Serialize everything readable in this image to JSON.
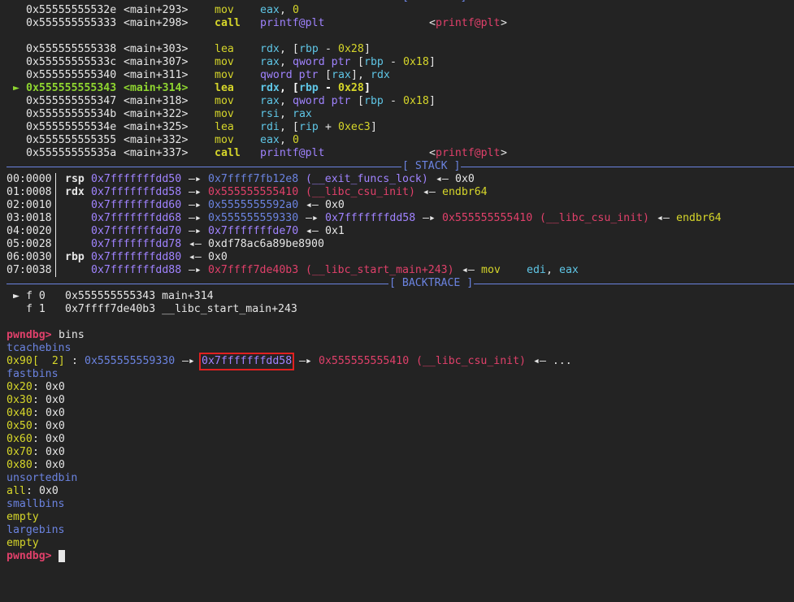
{
  "disasm": [
    {
      "addr": "0x55555555532e",
      "off": "<main+293>",
      "mn": "mov",
      "ops": [
        [
          "eax",
          "cy"
        ],
        [
          ", ",
          "w"
        ],
        [
          "0",
          "y"
        ]
      ]
    },
    {
      "addr": "0x555555555333",
      "off": "<main+298>",
      "mn": "call",
      "ops": [
        [
          "printf@plt",
          "pu"
        ]
      ],
      "target": "printf@plt",
      "call": true
    },
    {
      "blank": true
    },
    {
      "addr": "0x555555555338",
      "off": "<main+303>",
      "mn": "lea",
      "ops": [
        [
          "rdx",
          "cy"
        ],
        [
          ", [",
          "w"
        ],
        [
          "rbp",
          "cy"
        ],
        [
          " - ",
          "w"
        ],
        [
          "0x28",
          "y"
        ],
        [
          "]",
          "w"
        ]
      ]
    },
    {
      "addr": "0x55555555533c",
      "off": "<main+307>",
      "mn": "mov",
      "ops": [
        [
          "rax",
          "cy"
        ],
        [
          ", ",
          "w"
        ],
        [
          "qword ptr",
          "pu"
        ],
        [
          " [",
          "w"
        ],
        [
          "rbp",
          "cy"
        ],
        [
          " - ",
          "w"
        ],
        [
          "0x18",
          "y"
        ],
        [
          "]",
          "w"
        ]
      ]
    },
    {
      "addr": "0x555555555340",
      "off": "<main+311>",
      "mn": "mov",
      "ops": [
        [
          "qword ptr",
          "pu"
        ],
        [
          " [",
          "w"
        ],
        [
          "rax",
          "cy"
        ],
        [
          "], ",
          "w"
        ],
        [
          "rdx",
          "cy"
        ]
      ]
    },
    {
      "addr": "0x555555555343",
      "off": "<main+314>",
      "mn": "lea",
      "ops": [
        [
          "rdx",
          "cy"
        ],
        [
          ", [",
          "w"
        ],
        [
          "rbp",
          "cy"
        ],
        [
          " - ",
          "w"
        ],
        [
          "0x28",
          "y"
        ],
        [
          "]",
          "w"
        ]
      ],
      "current": true,
      "marker": "►"
    },
    {
      "addr": "0x555555555347",
      "off": "<main+318>",
      "mn": "mov",
      "ops": [
        [
          "rax",
          "cy"
        ],
        [
          ", ",
          "w"
        ],
        [
          "qword ptr",
          "pu"
        ],
        [
          " [",
          "w"
        ],
        [
          "rbp",
          "cy"
        ],
        [
          " - ",
          "w"
        ],
        [
          "0x18",
          "y"
        ],
        [
          "]",
          "w"
        ]
      ]
    },
    {
      "addr": "0x55555555534b",
      "off": "<main+322>",
      "mn": "mov",
      "ops": [
        [
          "rsi",
          "cy"
        ],
        [
          ", ",
          "w"
        ],
        [
          "rax",
          "cy"
        ]
      ]
    },
    {
      "addr": "0x55555555534e",
      "off": "<main+325>",
      "mn": "lea",
      "ops": [
        [
          "rdi",
          "cy"
        ],
        [
          ", [",
          "w"
        ],
        [
          "rip",
          "cy"
        ],
        [
          " + ",
          "w"
        ],
        [
          "0xec3",
          "y"
        ],
        [
          "]",
          "w"
        ]
      ]
    },
    {
      "addr": "0x555555555355",
      "off": "<main+332>",
      "mn": "mov",
      "ops": [
        [
          "eax",
          "cy"
        ],
        [
          ", ",
          "w"
        ],
        [
          "0",
          "y"
        ]
      ]
    },
    {
      "addr": "0x55555555535a",
      "off": "<main+337>",
      "mn": "call",
      "ops": [
        [
          "printf@plt",
          "pu"
        ]
      ],
      "target": "printf@plt",
      "call": true
    }
  ],
  "stack_label": "[ STACK ]",
  "stack": [
    {
      "idx": "00:0000",
      "reg": "rsp",
      "segs": [
        [
          "0x7fffffffdd50",
          "pu"
        ],
        [
          " —▸ ",
          "w"
        ],
        [
          "0x7ffff7fb12e8",
          "bl"
        ],
        [
          " (__exit_funcs_lock)",
          "pu"
        ],
        [
          " ◂— ",
          "w"
        ],
        [
          "0x0",
          "w"
        ]
      ]
    },
    {
      "idx": "01:0008",
      "reg": "rdx",
      "segs": [
        [
          "0x7fffffffdd58",
          "pu"
        ],
        [
          " —▸ ",
          "w"
        ],
        [
          "0x555555555410",
          "rd"
        ],
        [
          " (__libc_csu_init)",
          "rd"
        ],
        [
          " ◂— ",
          "w"
        ],
        [
          "endbr64",
          "y"
        ]
      ]
    },
    {
      "idx": "02:0010",
      "reg": "",
      "segs": [
        [
          "0x7fffffffdd60",
          "pu"
        ],
        [
          " —▸ ",
          "w"
        ],
        [
          "0x5555555592a0",
          "bl"
        ],
        [
          " ◂— ",
          "w"
        ],
        [
          "0x0",
          "w"
        ]
      ]
    },
    {
      "idx": "03:0018",
      "reg": "",
      "segs": [
        [
          "0x7fffffffdd68",
          "pu"
        ],
        [
          " —▸ ",
          "w"
        ],
        [
          "0x555555559330",
          "bl"
        ],
        [
          " —▸ ",
          "w"
        ],
        [
          "0x7fffffffdd58",
          "pu"
        ],
        [
          " —▸ ",
          "w"
        ],
        [
          "0x555555555410",
          "rd"
        ],
        [
          " (__libc_csu_init)",
          "rd"
        ],
        [
          " ◂— ",
          "w"
        ],
        [
          "endbr64",
          "y"
        ]
      ]
    },
    {
      "idx": "04:0020",
      "reg": "",
      "segs": [
        [
          "0x7fffffffdd70",
          "pu"
        ],
        [
          " —▸ ",
          "w"
        ],
        [
          "0x7fffffffde70",
          "pu"
        ],
        [
          " ◂— ",
          "w"
        ],
        [
          "0x1",
          "w"
        ]
      ]
    },
    {
      "idx": "05:0028",
      "reg": "",
      "segs": [
        [
          "0x7fffffffdd78",
          "pu"
        ],
        [
          " ◂— ",
          "w"
        ],
        [
          "0xdf78ac6a89be8900",
          "w"
        ]
      ]
    },
    {
      "idx": "06:0030",
      "reg": "rbp",
      "segs": [
        [
          "0x7fffffffdd80",
          "pu"
        ],
        [
          " ◂— ",
          "w"
        ],
        [
          "0x0",
          "w"
        ]
      ]
    },
    {
      "idx": "07:0038",
      "reg": "",
      "segs": [
        [
          "0x7fffffffdd88",
          "pu"
        ],
        [
          " —▸ ",
          "w"
        ],
        [
          "0x7ffff7de40b3",
          "rd"
        ],
        [
          " (__libc_start_main+243)",
          "rd"
        ],
        [
          " ◂— ",
          "w"
        ],
        [
          "mov",
          "y"
        ],
        [
          "    ",
          "w"
        ],
        [
          "edi",
          "cy"
        ],
        [
          ", ",
          "w"
        ],
        [
          "eax",
          "cy"
        ]
      ]
    }
  ],
  "backtrace_label": "[ BACKTRACE ]",
  "backtrace": [
    {
      "marker": "►",
      "frame": "f 0",
      "text": "0x555555555343 main+314"
    },
    {
      "marker": "",
      "frame": "f 1",
      "text": "0x7ffff7de40b3 __libc_start_main+243"
    }
  ],
  "prompt": "pwndbg>",
  "command": "bins",
  "tcache": {
    "heading": "tcachebins",
    "size": "0x90",
    "count": "[  2]",
    "first": "0x555555559330",
    "highlighted": "0x7fffffffdd58",
    "next": "0x555555555410",
    "next_sym": "(__libc_csu_init)",
    "tail": "◂— ..."
  },
  "fastbins_heading": "fastbins",
  "fastbins": [
    {
      "size": "0x20",
      "val": "0x0"
    },
    {
      "size": "0x30",
      "val": "0x0"
    },
    {
      "size": "0x40",
      "val": "0x0"
    },
    {
      "size": "0x50",
      "val": "0x0"
    },
    {
      "size": "0x60",
      "val": "0x0"
    },
    {
      "size": "0x70",
      "val": "0x0"
    },
    {
      "size": "0x80",
      "val": "0x0"
    }
  ],
  "unsortedbin": {
    "heading": "unsortedbin",
    "label": "all",
    "val": "0x0"
  },
  "smallbins": {
    "heading": "smallbins",
    "val": "empty"
  },
  "largebins": {
    "heading": "largebins",
    "val": "empty"
  },
  "colors": {
    "background": "#232323",
    "separator": "#6b83e0",
    "highlight_box": "#e02020"
  }
}
